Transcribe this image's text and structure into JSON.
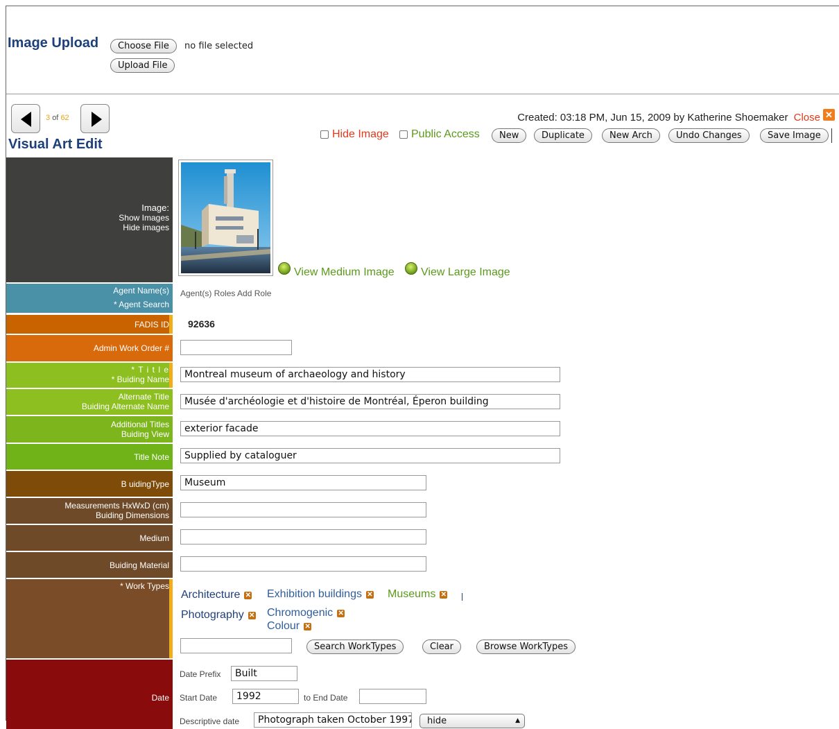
{
  "upload": {
    "title": "Image Upload",
    "choose_file_label": "Choose File",
    "no_file_text": "no file selected",
    "upload_file_label": "Upload File"
  },
  "header": {
    "page_current": "3",
    "page_of_text": "of",
    "page_total": "62",
    "title": "Visual Art Edit",
    "created_text": "Created: 03:18 PM, Jun 15, 2009 by Katherine Shoemaker",
    "close_label": "Close",
    "hide_image_label": "Hide Image",
    "public_access_label": "Public Access",
    "buttons": {
      "new": "New",
      "duplicate": "Duplicate",
      "new_arch": "New Arch",
      "undo": "Undo Changes",
      "save": "Save Image"
    }
  },
  "colors": {
    "dark_gray": "#3f3f3d",
    "blue": "#4a91a8",
    "orange": "#c96300",
    "orange_light": "#d96a0c",
    "green_yellow": "#8cbf1f",
    "green": "#6fb319",
    "brown_gold": "#7e4b09",
    "brown": "#6e4a28",
    "dark_red": "#8a0b0b",
    "accent_yellow": "#f2ad1a",
    "work_type_blue": "#2f5d9a",
    "work_type_green": "#5a9a1a"
  },
  "form": {
    "image": {
      "label": "Image:",
      "show_images": "Show Images",
      "hide_images": "Hide images",
      "view_medium": "View Medium Image",
      "view_large": "View Large Image"
    },
    "agent": {
      "label1": "Agent Name(s)",
      "label2": "* Agent Search",
      "value": "Agent(s) Roles Add Role"
    },
    "fadis": {
      "label": "FADIS ID",
      "value": "92636"
    },
    "admin_work_order": {
      "label": "Admin Work Order #",
      "value": ""
    },
    "title": {
      "label1": "* T i t l e",
      "label2": "* Buiding Name",
      "value": "Montreal museum of archaeology and history"
    },
    "alternate_title": {
      "label1": "Alternate Title",
      "label2": "Buiding Alternate Name",
      "value": "Musée d'archéologie et d'histoire de Montréal,  Éperon building"
    },
    "additional_titles": {
      "label1": "Additional Titles",
      "label2": "Buiding View",
      "value": "exterior facade"
    },
    "title_note": {
      "label": "Title Note",
      "value": "Supplied by cataloguer"
    },
    "building_type": {
      "label": "B uidingType",
      "value": "Museum"
    },
    "measurements": {
      "label1": "Measurements HxWxD (cm)",
      "label2": "Buiding Dimensions",
      "value": ""
    },
    "medium": {
      "label": "Medium",
      "value": ""
    },
    "building_material": {
      "label": "Buiding Material",
      "value": ""
    },
    "work_types": {
      "label": "* Work Types",
      "items": [
        "Architecture",
        "Exhibition buildings",
        "Museums",
        "Photography",
        "Chromogenic",
        "Colour"
      ],
      "search_value": "",
      "search_button": "Search WorkTypes",
      "clear_button": "Clear",
      "browse_button": "Browse WorkTypes"
    },
    "date": {
      "label": "Date",
      "prefix_label": "Date Prefix",
      "prefix_value": "Built",
      "start_label": "Start Date",
      "start_value": "1992",
      "end_label": "to End Date",
      "end_value": "",
      "descriptive_label": "Descriptive date",
      "descriptive_value": "Photograph taken October 1997",
      "descriptive_select": "hide"
    }
  }
}
